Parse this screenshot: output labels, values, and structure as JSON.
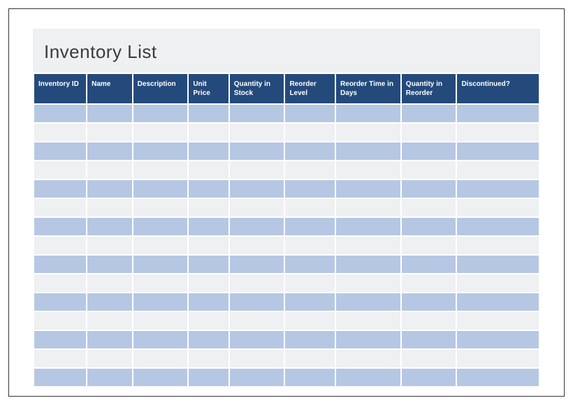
{
  "header": {
    "title": "Inventory List"
  },
  "table": {
    "columns": [
      "Inventory ID",
      "Name",
      "Description",
      "Unit Price",
      "Quantity in Stock",
      "Reorder Level",
      "Reorder Time in Days",
      "Quantity in Reorder",
      "Discontinued?"
    ],
    "rows": [
      [
        "",
        "",
        "",
        "",
        "",
        "",
        "",
        "",
        ""
      ],
      [
        "",
        "",
        "",
        "",
        "",
        "",
        "",
        "",
        ""
      ],
      [
        "",
        "",
        "",
        "",
        "",
        "",
        "",
        "",
        ""
      ],
      [
        "",
        "",
        "",
        "",
        "",
        "",
        "",
        "",
        ""
      ],
      [
        "",
        "",
        "",
        "",
        "",
        "",
        "",
        "",
        ""
      ],
      [
        "",
        "",
        "",
        "",
        "",
        "",
        "",
        "",
        ""
      ],
      [
        "",
        "",
        "",
        "",
        "",
        "",
        "",
        "",
        ""
      ],
      [
        "",
        "",
        "",
        "",
        "",
        "",
        "",
        "",
        ""
      ],
      [
        "",
        "",
        "",
        "",
        "",
        "",
        "",
        "",
        ""
      ],
      [
        "",
        "",
        "",
        "",
        "",
        "",
        "",
        "",
        ""
      ],
      [
        "",
        "",
        "",
        "",
        "",
        "",
        "",
        "",
        ""
      ],
      [
        "",
        "",
        "",
        "",
        "",
        "",
        "",
        "",
        ""
      ],
      [
        "",
        "",
        "",
        "",
        "",
        "",
        "",
        "",
        ""
      ],
      [
        "",
        "",
        "",
        "",
        "",
        "",
        "",
        "",
        ""
      ],
      [
        "",
        "",
        "",
        "",
        "",
        "",
        "",
        "",
        ""
      ]
    ]
  },
  "colors": {
    "header_bg": "#244a7c",
    "row_odd_bg": "#b6c7e3",
    "row_even_bg": "#eef0f1"
  }
}
